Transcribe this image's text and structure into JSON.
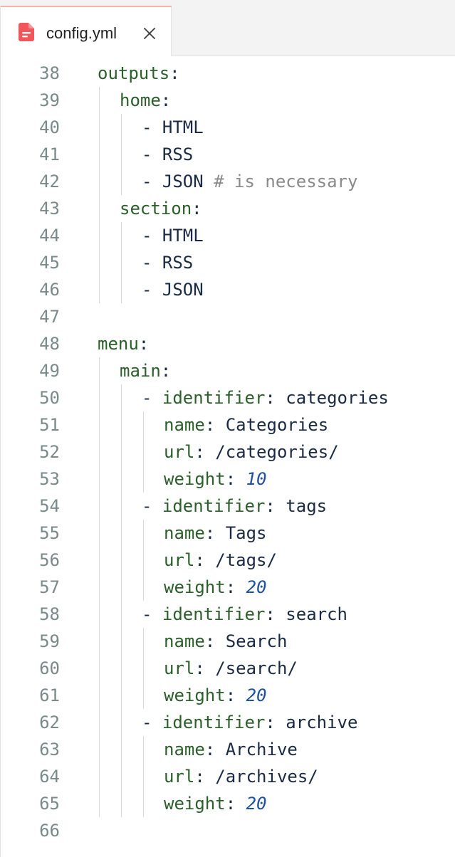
{
  "tab": {
    "filename": "config.yml",
    "file_icon": "file-document-icon",
    "close_icon": "close-icon",
    "icon_color": "#f0565a"
  },
  "editor": {
    "lines": [
      {
        "number": "38",
        "indent": 0,
        "parts": [
          {
            "t": "outputs",
            "k": "key"
          },
          {
            "t": ":",
            "k": "plain"
          }
        ]
      },
      {
        "number": "39",
        "indent": 1,
        "parts": [
          {
            "t": "home",
            "k": "key"
          },
          {
            "t": ":",
            "k": "plain"
          }
        ]
      },
      {
        "number": "40",
        "indent": 2,
        "parts": [
          {
            "t": "- HTML",
            "k": "plain"
          }
        ]
      },
      {
        "number": "41",
        "indent": 2,
        "parts": [
          {
            "t": "- RSS",
            "k": "plain"
          }
        ]
      },
      {
        "number": "42",
        "indent": 2,
        "parts": [
          {
            "t": "- JSON ",
            "k": "plain"
          },
          {
            "t": "# is necessary",
            "k": "comment"
          }
        ]
      },
      {
        "number": "43",
        "indent": 1,
        "parts": [
          {
            "t": "section",
            "k": "key"
          },
          {
            "t": ":",
            "k": "plain"
          }
        ]
      },
      {
        "number": "44",
        "indent": 2,
        "parts": [
          {
            "t": "- HTML",
            "k": "plain"
          }
        ]
      },
      {
        "number": "45",
        "indent": 2,
        "parts": [
          {
            "t": "- RSS",
            "k": "plain"
          }
        ]
      },
      {
        "number": "46",
        "indent": 2,
        "parts": [
          {
            "t": "- JSON",
            "k": "plain"
          }
        ]
      },
      {
        "number": "47",
        "indent": 0,
        "parts": []
      },
      {
        "number": "48",
        "indent": 0,
        "parts": [
          {
            "t": "menu",
            "k": "key"
          },
          {
            "t": ":",
            "k": "plain"
          }
        ]
      },
      {
        "number": "49",
        "indent": 1,
        "parts": [
          {
            "t": "main",
            "k": "key"
          },
          {
            "t": ":",
            "k": "plain"
          }
        ]
      },
      {
        "number": "50",
        "indent": 2,
        "parts": [
          {
            "t": "- ",
            "k": "plain"
          },
          {
            "t": "identifier",
            "k": "key"
          },
          {
            "t": ": categories",
            "k": "plain"
          }
        ]
      },
      {
        "number": "51",
        "indent": 3,
        "parts": [
          {
            "t": "name",
            "k": "key"
          },
          {
            "t": ": Categories",
            "k": "plain"
          }
        ]
      },
      {
        "number": "52",
        "indent": 3,
        "parts": [
          {
            "t": "url",
            "k": "key"
          },
          {
            "t": ": /categories/",
            "k": "plain"
          }
        ]
      },
      {
        "number": "53",
        "indent": 3,
        "parts": [
          {
            "t": "weight",
            "k": "key"
          },
          {
            "t": ": ",
            "k": "plain"
          },
          {
            "t": "10",
            "k": "number"
          }
        ]
      },
      {
        "number": "54",
        "indent": 2,
        "parts": [
          {
            "t": "- ",
            "k": "plain"
          },
          {
            "t": "identifier",
            "k": "key"
          },
          {
            "t": ": tags",
            "k": "plain"
          }
        ]
      },
      {
        "number": "55",
        "indent": 3,
        "parts": [
          {
            "t": "name",
            "k": "key"
          },
          {
            "t": ": Tags",
            "k": "plain"
          }
        ]
      },
      {
        "number": "56",
        "indent": 3,
        "parts": [
          {
            "t": "url",
            "k": "key"
          },
          {
            "t": ": /tags/",
            "k": "plain"
          }
        ]
      },
      {
        "number": "57",
        "indent": 3,
        "parts": [
          {
            "t": "weight",
            "k": "key"
          },
          {
            "t": ": ",
            "k": "plain"
          },
          {
            "t": "20",
            "k": "number"
          }
        ]
      },
      {
        "number": "58",
        "indent": 2,
        "parts": [
          {
            "t": "- ",
            "k": "plain"
          },
          {
            "t": "identifier",
            "k": "key"
          },
          {
            "t": ": search",
            "k": "plain"
          }
        ]
      },
      {
        "number": "59",
        "indent": 3,
        "parts": [
          {
            "t": "name",
            "k": "key"
          },
          {
            "t": ": Search",
            "k": "plain"
          }
        ]
      },
      {
        "number": "60",
        "indent": 3,
        "parts": [
          {
            "t": "url",
            "k": "key"
          },
          {
            "t": ": /search/",
            "k": "plain"
          }
        ]
      },
      {
        "number": "61",
        "indent": 3,
        "parts": [
          {
            "t": "weight",
            "k": "key"
          },
          {
            "t": ": ",
            "k": "plain"
          },
          {
            "t": "20",
            "k": "number"
          }
        ]
      },
      {
        "number": "62",
        "indent": 2,
        "parts": [
          {
            "t": "- ",
            "k": "plain"
          },
          {
            "t": "identifier",
            "k": "key"
          },
          {
            "t": ": archive",
            "k": "plain"
          }
        ]
      },
      {
        "number": "63",
        "indent": 3,
        "parts": [
          {
            "t": "name",
            "k": "key"
          },
          {
            "t": ": Archive",
            "k": "plain"
          }
        ]
      },
      {
        "number": "64",
        "indent": 3,
        "parts": [
          {
            "t": "url",
            "k": "key"
          },
          {
            "t": ": /archives/",
            "k": "plain"
          }
        ]
      },
      {
        "number": "65",
        "indent": 3,
        "parts": [
          {
            "t": "weight",
            "k": "key"
          },
          {
            "t": ": ",
            "k": "plain"
          },
          {
            "t": "20",
            "k": "number"
          }
        ]
      },
      {
        "number": "66",
        "indent": 0,
        "parts": []
      }
    ]
  }
}
